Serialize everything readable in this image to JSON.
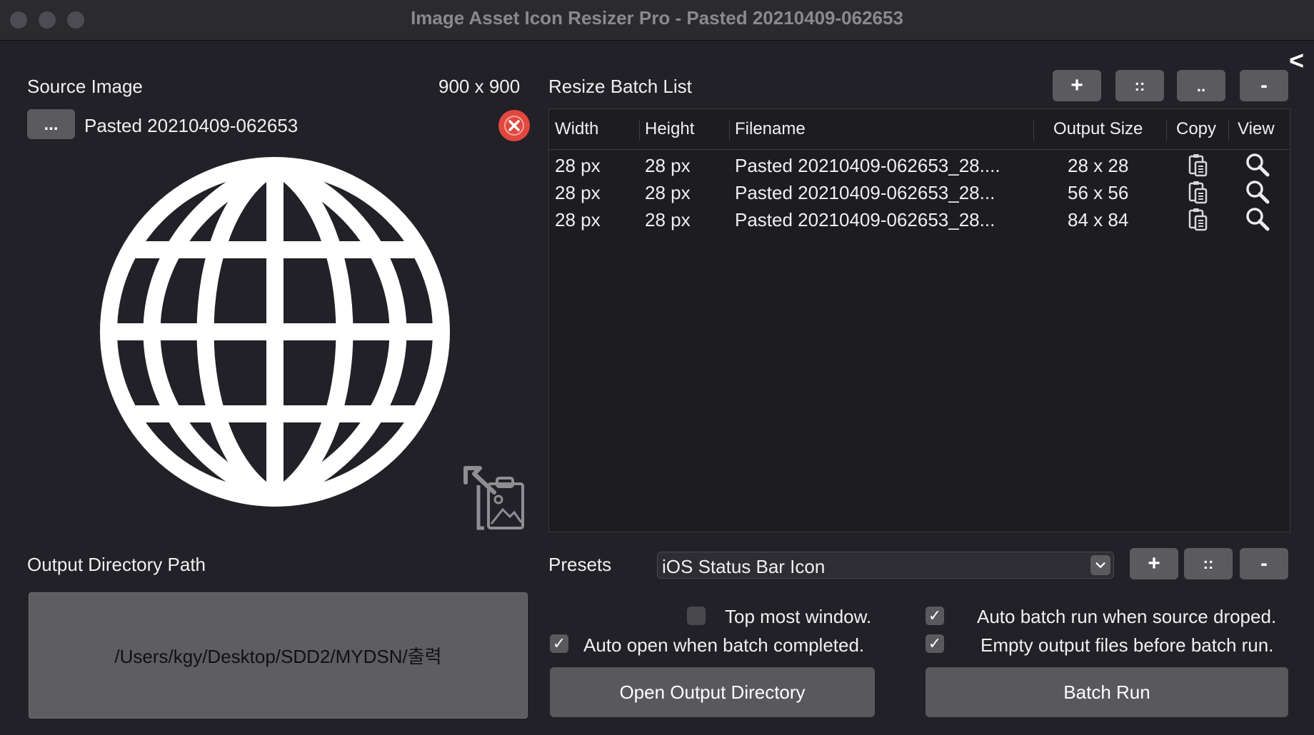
{
  "window": {
    "title": "Image Asset Icon Resizer Pro - Pasted 20210409-062653",
    "collapse_glyph": "<"
  },
  "source": {
    "heading": "Source Image",
    "dimensions": "900 x 900",
    "browse_label": "...",
    "filename": "Pasted 20210409-062653"
  },
  "batch": {
    "heading": "Resize Batch List",
    "add_label": "+",
    "grid_label": "::",
    "dots_label": "..",
    "remove_label": "-",
    "columns": [
      "Width",
      "Height",
      "Filename",
      "Output Size",
      "Copy",
      "View"
    ],
    "rows": [
      {
        "width": "28 px",
        "height": "28 px",
        "filename": "Pasted 20210409-062653_28....",
        "output": "28 x 28"
      },
      {
        "width": "28 px",
        "height": "28 px",
        "filename": "Pasted 20210409-062653_28...",
        "output": "56 x 56"
      },
      {
        "width": "28 px",
        "height": "28 px",
        "filename": "Pasted 20210409-062653_28...",
        "output": "84 x 84"
      }
    ]
  },
  "output": {
    "heading": "Output Directory Path",
    "path": "/Users/kgy/Desktop/SDD2/MYDSN/출력"
  },
  "presets": {
    "label": "Presets",
    "selected": "iOS Status Bar Icon",
    "add_label": "+",
    "grid_label": "::",
    "remove_label": "-"
  },
  "options": {
    "top_most": {
      "label": "Top most window.",
      "checked": false
    },
    "auto_batch": {
      "label": "Auto batch run when source droped.",
      "checked": true
    },
    "auto_open": {
      "label": "Auto open when batch completed.",
      "checked": true
    },
    "empty_output": {
      "label": "Empty output files before batch run.",
      "checked": true
    }
  },
  "actions": {
    "open_output": "Open Output Directory",
    "batch_run": "Batch Run"
  },
  "colors": {
    "background": "#222127",
    "button": "#5b5a5f",
    "clear_red": "#e0483f"
  }
}
